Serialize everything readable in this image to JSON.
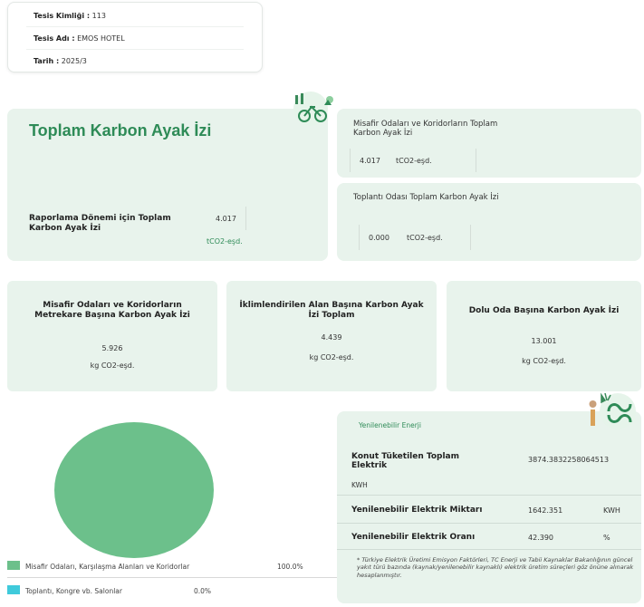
{
  "facility": {
    "id_label": "Tesis Kimliği :",
    "id_value": "113",
    "name_label": "Tesis Adı :",
    "name_value": "EMOS HOTEL",
    "date_label": "Tarih :",
    "date_value": "2025/3"
  },
  "total": {
    "title": "Toplam Karbon Ayak İzi",
    "period_label": "Raporlama Dönemi için Toplam Karbon Ayak İzi",
    "period_value": "4.017",
    "period_unit": "tCO2-eşd."
  },
  "guest_rooms": {
    "label": "Misafir Odaları ve Koridorların Toplam Karbon Ayak İzi",
    "value": "4.017",
    "unit": "tCO2-eşd."
  },
  "meeting_rooms": {
    "label": "Toplantı Odası Toplam Karbon Ayak İzi",
    "value": "0.000",
    "unit": "tCO2-eşd."
  },
  "metrics": [
    {
      "title": "Misafir Odaları ve Koridorların Metrekare Başına Karbon Ayak İzi",
      "value": "5.926",
      "unit": "kg CO2-eşd."
    },
    {
      "title": "İklimlendirilen Alan Başına Karbon Ayak İzi Toplam",
      "value": "4.439",
      "unit": "kg CO2-eşd."
    },
    {
      "title": "Dolu Oda Başına Karbon Ayak İzi",
      "value": "13.001",
      "unit": "kg CO2-eşd."
    }
  ],
  "chart_data": {
    "type": "pie",
    "series": [
      {
        "name": "Misafir Odaları, Karşılaşma Alanları ve Koridorlar",
        "value": 100.0,
        "label": "100.0%",
        "color": "#6cc08b"
      },
      {
        "name": "Toplantı, Kongre vb. Salonlar",
        "value": 0.0,
        "label": "0.0%",
        "color": "#3fcadb"
      }
    ]
  },
  "renewable": {
    "header": "Yenilenebilir Enerji",
    "consumed_label": "Konut Tüketilen Toplam Elektrik",
    "consumed_value": "3874.3832258064513",
    "consumed_unit": "KWH",
    "amount_label": "Yenilenebilir Elektrik Miktarı",
    "amount_value": "1642.351",
    "amount_unit": "KWH",
    "ratio_label": "Yenilenebilir Elektrik Oranı",
    "ratio_value": "42.390",
    "ratio_unit": "%",
    "footnote": "* Türkiye Elektrik Üretimi Emisyon Faktörleri, TC Enerji ve Tabii Kaynaklar Bakanlığının güncel yakıt türü bazında (kaynak/yenilenebilir kaynaklı) elektrik üretim süreçleri göz önüne alınarak hesaplanmıştır."
  },
  "colors": {
    "card_bg": "#e8f3ec",
    "accent_green": "#2e8b57",
    "pie_green": "#6cc08b",
    "pie_cyan": "#3fcadb"
  },
  "icons": {
    "top": "eco-bicycle-icon",
    "renewable": "renewable-energy-icon"
  }
}
